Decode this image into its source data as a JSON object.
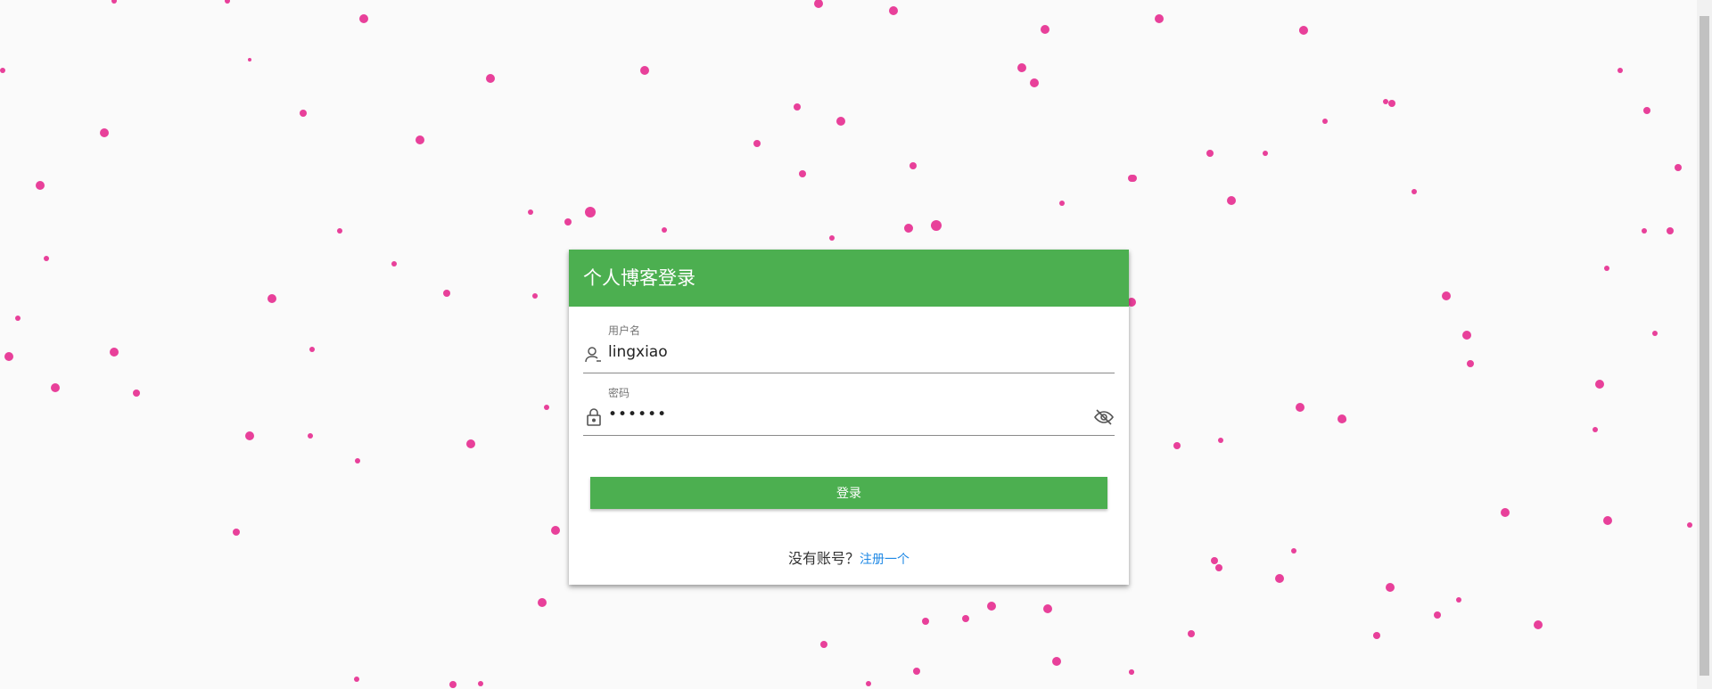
{
  "login": {
    "title": "个人博客登录",
    "username_label": "用户名",
    "username_value": "lingxiao",
    "password_label": "密码",
    "password_value": "••••••",
    "login_button": "登录",
    "no_account_text": "没有账号？",
    "register_link": "注册一个"
  },
  "colors": {
    "primary": "#4caf50",
    "particle": "#e8409a",
    "link": "#1e88e5",
    "background": "#fafafa"
  },
  "icons": {
    "username": "user-icon",
    "password": "lock-icon",
    "toggle_password": "eye-off-icon"
  }
}
